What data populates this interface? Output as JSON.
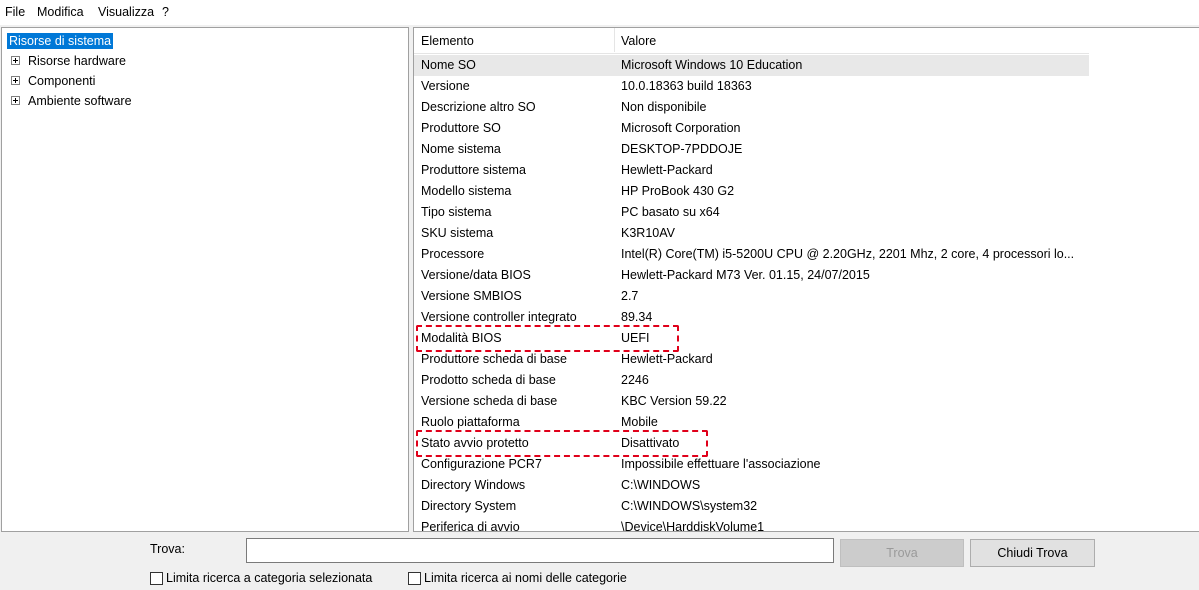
{
  "menu": {
    "items": [
      "File",
      "Modifica",
      "Visualizza",
      "?"
    ]
  },
  "tree": {
    "root": "Risorse di sistema",
    "children": [
      "Risorse hardware",
      "Componenti",
      "Ambiente software"
    ]
  },
  "list": {
    "columns": {
      "key": "Elemento",
      "value": "Valore"
    },
    "rows": [
      {
        "k": "Nome SO",
        "v": "Microsoft Windows 10 Education"
      },
      {
        "k": "Versione",
        "v": "10.0.18363 build 18363"
      },
      {
        "k": "Descrizione altro SO",
        "v": "Non disponibile"
      },
      {
        "k": "Produttore SO",
        "v": "Microsoft Corporation"
      },
      {
        "k": "Nome sistema",
        "v": "DESKTOP-7PDDOJE"
      },
      {
        "k": "Produttore sistema",
        "v": "Hewlett-Packard"
      },
      {
        "k": "Modello sistema",
        "v": "HP ProBook 430 G2"
      },
      {
        "k": "Tipo sistema",
        "v": "PC basato su x64"
      },
      {
        "k": "SKU sistema",
        "v": "K3R10AV"
      },
      {
        "k": "Processore",
        "v": "Intel(R) Core(TM) i5-5200U CPU @ 2.20GHz, 2201 Mhz, 2 core, 4 processori lo..."
      },
      {
        "k": "Versione/data BIOS",
        "v": "Hewlett-Packard M73 Ver. 01.15, 24/07/2015"
      },
      {
        "k": "Versione SMBIOS",
        "v": "2.7"
      },
      {
        "k": "Versione controller integrato",
        "v": "89.34"
      },
      {
        "k": "Modalità BIOS",
        "v": "UEFI"
      },
      {
        "k": "Produttore scheda di base",
        "v": "Hewlett-Packard"
      },
      {
        "k": "Prodotto scheda di base",
        "v": "2246"
      },
      {
        "k": "Versione scheda di base",
        "v": "KBC Version 59.22"
      },
      {
        "k": "Ruolo piattaforma",
        "v": "Mobile"
      },
      {
        "k": "Stato avvio protetto",
        "v": "Disattivato"
      },
      {
        "k": "Configurazione PCR7",
        "v": "Impossibile effettuare l'associazione"
      },
      {
        "k": "Directory Windows",
        "v": "C:\\WINDOWS"
      },
      {
        "k": "Directory System",
        "v": "C:\\WINDOWS\\system32"
      },
      {
        "k": "Periferica di avvio",
        "v": "\\Device\\HarddiskVolume1"
      }
    ]
  },
  "search": {
    "label": "Trova:",
    "value": "",
    "find_button": "Trova",
    "close_button": "Chiudi Trova",
    "check_category": "Limita ricerca a categoria selezionata",
    "check_names": "Limita ricerca ai nomi delle categorie"
  },
  "colors": {
    "selection": "#0078d7",
    "highlight": "#e0001a"
  }
}
